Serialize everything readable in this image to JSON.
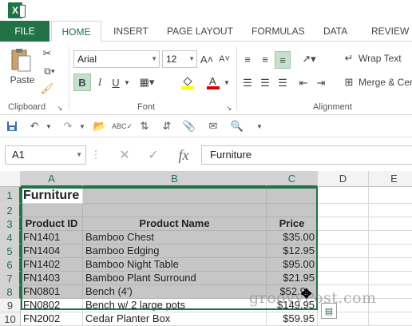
{
  "app": {
    "icon_label": "X"
  },
  "tabs": [
    "FILE",
    "HOME",
    "INSERT",
    "PAGE LAYOUT",
    "FORMULAS",
    "DATA",
    "REVIEW"
  ],
  "ribbon": {
    "paste_label": "Paste",
    "font_name": "Arial",
    "font_size": "12",
    "wrap_text_label": "Wrap Text",
    "merge_label": "Merge & Cer",
    "groups": [
      "Clipboard",
      "Font",
      "Alignment"
    ],
    "font_btn_B": "B",
    "font_btn_I": "I",
    "font_btn_U": "U"
  },
  "formula_bar": {
    "name_box": "A1",
    "fx_label": "fx",
    "content": "Furniture"
  },
  "columns": [
    "A",
    "B",
    "C",
    "D",
    "E"
  ],
  "rows": [
    "1",
    "2",
    "3",
    "4",
    "5",
    "6",
    "7",
    "8",
    "9",
    "10"
  ],
  "table": {
    "title": "Furniture",
    "headers": [
      "Product ID",
      "Product Name",
      "Price"
    ],
    "rows": [
      [
        "FN1401",
        "Bamboo Chest",
        "$35.00"
      ],
      [
        "FN1404",
        "Bamboo Edging",
        "$12.95"
      ],
      [
        "FN1402",
        "Bamboo Night Table",
        "$95.00"
      ],
      [
        "FN1403",
        "Bamboo Plant Surround",
        "$21.95"
      ],
      [
        "FN0801",
        "Bench (4')",
        "$52.9"
      ],
      [
        "FN0802",
        "Bench w/ 2 large pots",
        "$149.95"
      ],
      [
        "FN2002",
        "Cedar Planter Box",
        "$59.95"
      ]
    ]
  },
  "watermark": "groovyPost.com",
  "colors": {
    "accent": "#217346",
    "selection": "#c6c6c6"
  }
}
